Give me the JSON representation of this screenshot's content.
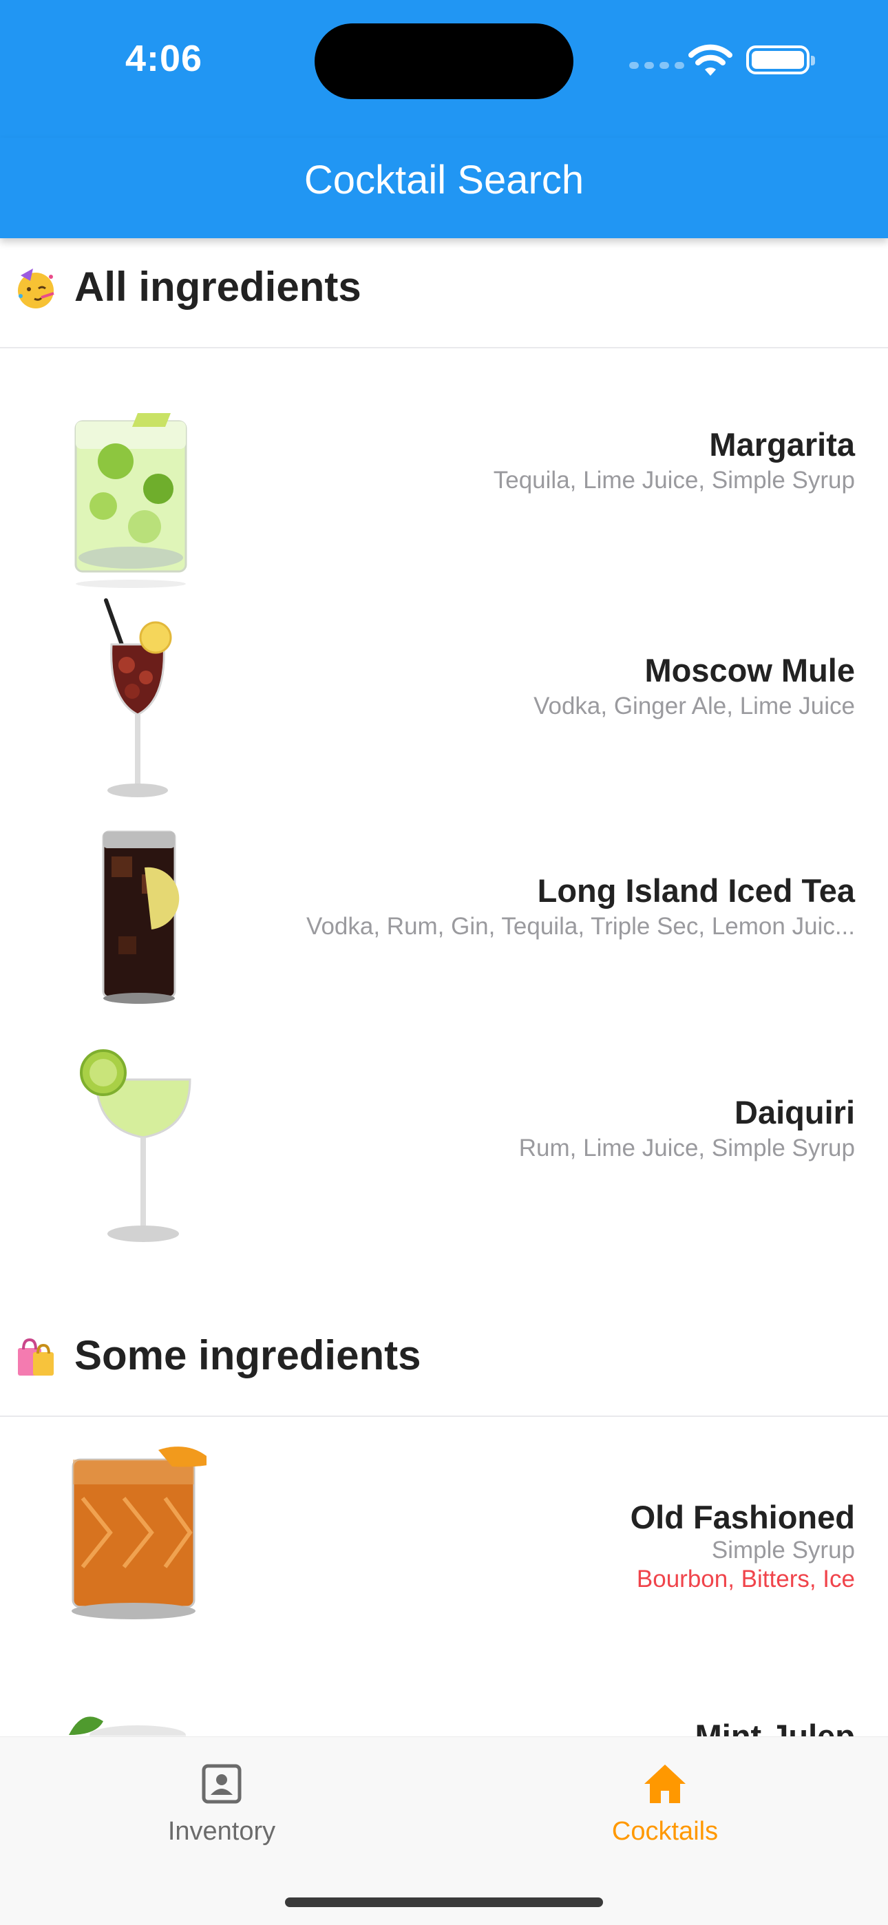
{
  "status_bar": {
    "time": "4:06"
  },
  "nav": {
    "title": "Cocktail Search"
  },
  "sections": {
    "all": {
      "emoji": "party-face-icon",
      "title": "All ingredients"
    },
    "some": {
      "emoji": "shopping-bags-icon",
      "title": "Some ingredients"
    }
  },
  "cocktails": [
    {
      "name": "Margarita",
      "have": "Tequila, Lime Juice, Simple Syrup",
      "image": "margarita-glass"
    },
    {
      "name": "Moscow Mule",
      "have": "Vodka, Ginger Ale, Lime Juice",
      "image": "wine-glass-cocktail"
    },
    {
      "name": "Long Island Iced Tea",
      "have": "Vodka, Rum, Gin, Tequila, Triple Sec, Lemon Juic...",
      "image": "highball-glass"
    },
    {
      "name": "Daiquiri",
      "have": "Rum, Lime Juice, Simple Syrup",
      "image": "coupe-glass"
    },
    {
      "name": "Old Fashioned",
      "have": "Simple Syrup",
      "missing": "Bourbon, Bitters, Ice",
      "image": "rocks-glass"
    },
    {
      "name": "Mint Julep",
      "image": "mint-julep-cup"
    }
  ],
  "tabs": [
    {
      "label": "Inventory",
      "icon": "contact-card-icon",
      "active": false
    },
    {
      "label": "Cocktails",
      "icon": "home-icon",
      "active": true
    }
  ],
  "colors": {
    "primary": "#2196f3",
    "accent": "#ff9800",
    "missing": "#f0444b"
  }
}
